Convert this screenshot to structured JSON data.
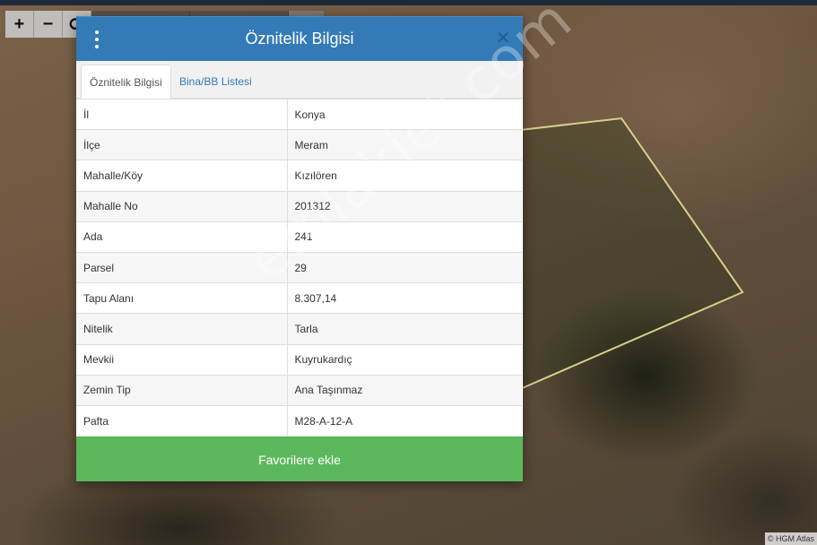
{
  "map": {
    "tools": {
      "zoom_in": "+",
      "zoom_out": "−",
      "refresh": "⟳"
    },
    "attribution": "© HGM Atlas",
    "parcel_outline_color": "#d6cf8a"
  },
  "modal": {
    "title": "Öznitelik Bilgisi",
    "close": "✕",
    "tabs": [
      {
        "label": "Öznitelik Bilgisi",
        "active": true
      },
      {
        "label": "Bina/BB Listesi",
        "active": false
      }
    ],
    "rows": [
      {
        "key": "İl",
        "value": "Konya"
      },
      {
        "key": "İlçe",
        "value": "Meram"
      },
      {
        "key": "Mahalle/Köy",
        "value": "Kızılören"
      },
      {
        "key": "Mahalle No",
        "value": "201312"
      },
      {
        "key": "Ada",
        "value": "241"
      },
      {
        "key": "Parsel",
        "value": "29"
      },
      {
        "key": "Tapu Alanı",
        "value": "8.307,14"
      },
      {
        "key": "Nitelik",
        "value": "Tarla"
      },
      {
        "key": "Mevkii",
        "value": "Kuyrukardıç"
      },
      {
        "key": "Zemin Tip",
        "value": "Ana Taşınmaz"
      },
      {
        "key": "Pafta",
        "value": "M28-A-12-A"
      }
    ],
    "favorite_button": "Favorilere ekle"
  },
  "watermark": "emlakjet.com",
  "colors": {
    "header": "#337ab7",
    "button": "#5cb85c"
  }
}
